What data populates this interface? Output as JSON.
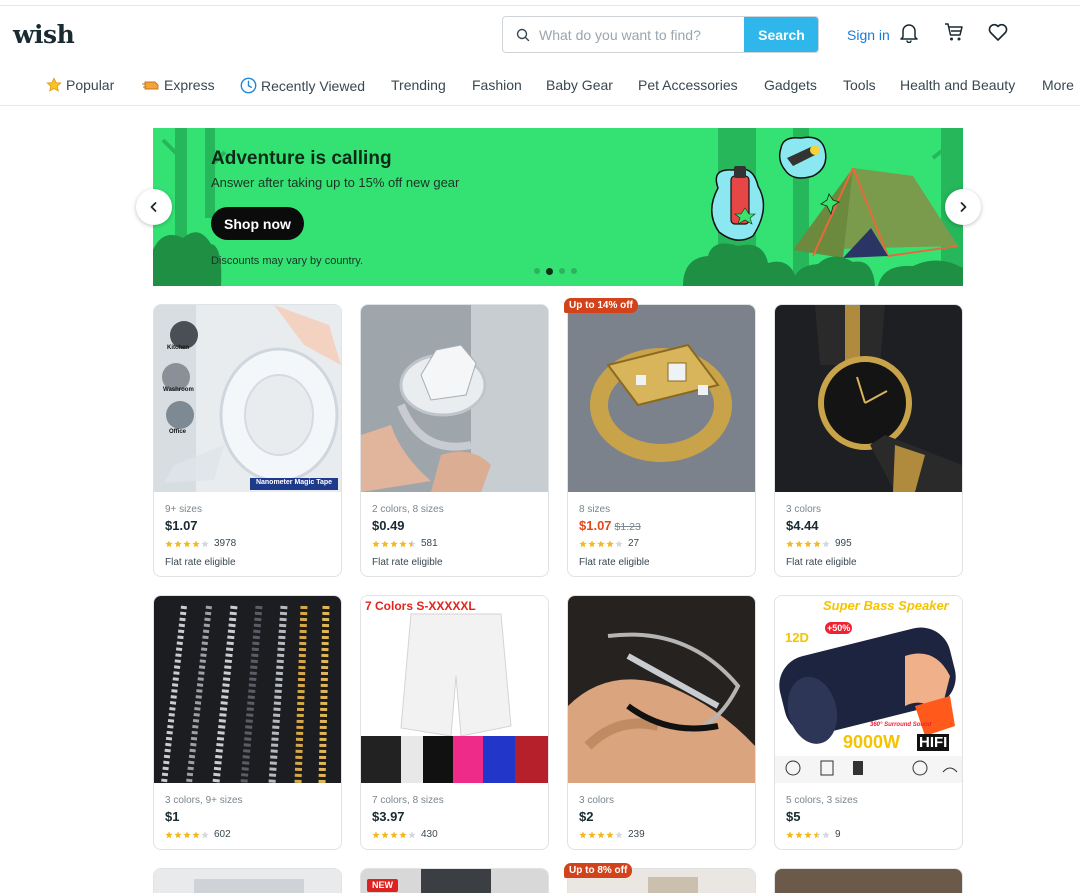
{
  "header": {
    "logo": "wish",
    "search_placeholder": "What do you want to find?",
    "search_button": "Search",
    "signin": "Sign in"
  },
  "nav": {
    "items": [
      {
        "label": "Popular",
        "icon": "star-icon"
      },
      {
        "label": "Express",
        "icon": "express-icon"
      },
      {
        "label": "Recently Viewed",
        "icon": "clock-icon"
      },
      {
        "label": "Trending"
      },
      {
        "label": "Fashion"
      },
      {
        "label": "Baby Gear"
      },
      {
        "label": "Pet Accessories"
      },
      {
        "label": "Gadgets"
      },
      {
        "label": "Tools"
      },
      {
        "label": "Health and Beauty"
      },
      {
        "label": "More"
      }
    ]
  },
  "banner": {
    "title": "Adventure is calling",
    "subtitle": "Answer after taking up to 15% off new gear",
    "button": "Shop now",
    "note": "Discounts may vary by country.",
    "dots": 4,
    "active_dot": 1,
    "colors": {
      "background": "#34e274",
      "button": "#0b0b0b"
    }
  },
  "products": [
    {
      "meta": "9+ sizes",
      "price": "$1.07",
      "rating": 4,
      "count": "3978",
      "flat": "Flat rate eligible",
      "image_caption": "Nanometer Magic Tape",
      "image_labels": [
        "Kitchen",
        "Washroom",
        "Office"
      ]
    },
    {
      "meta": "2 colors, 8 sizes",
      "price": "$0.49",
      "rating": 4.5,
      "count": "581",
      "flat": "Flat rate eligible"
    },
    {
      "meta": "8 sizes",
      "price": "$1.07",
      "original": "$1.23",
      "sale": true,
      "badge": "Up to 14% off",
      "rating": 4,
      "count": "27",
      "flat": "Flat rate eligible"
    },
    {
      "meta": "3 colors",
      "price": "$4.44",
      "rating": 4,
      "count": "995",
      "flat": "Flat rate eligible"
    },
    {
      "meta": "3 colors, 9+ sizes",
      "price": "$1",
      "rating": 4,
      "count": "602"
    },
    {
      "meta": "7 colors, 8 sizes",
      "price": "$3.97",
      "rating": 4,
      "count": "430",
      "image_caption": "7 Colors S-XXXXXL"
    },
    {
      "meta": "3 colors",
      "price": "$2",
      "rating": 4,
      "count": "239"
    },
    {
      "meta": "5 colors, 3 sizes",
      "price": "$5",
      "rating": 3.5,
      "count": "9",
      "image_caption": "Super Bass Speaker",
      "image_labels": [
        "12D",
        "+50%",
        "360° Surround Sound",
        "9000W",
        "HIFI"
      ]
    }
  ],
  "partial_row": {
    "badges": [
      "NEW",
      "Up to 8% off"
    ]
  },
  "colors": {
    "accent": "#2fb7ec",
    "link": "#1a7bd6",
    "sale": "#e14a1a",
    "star": "#f5b81c"
  }
}
